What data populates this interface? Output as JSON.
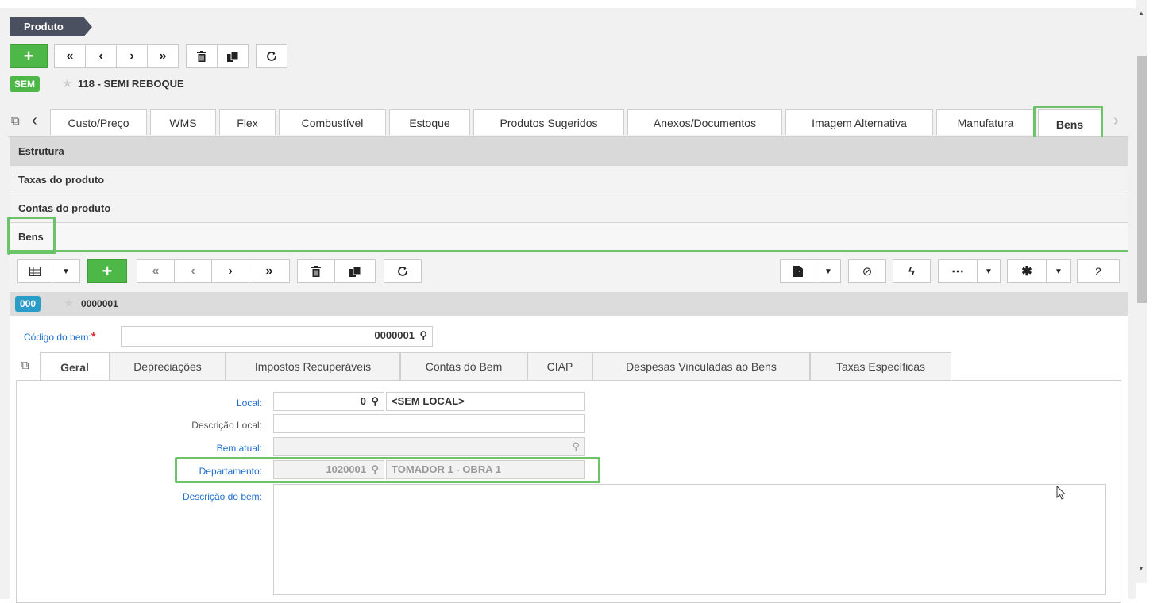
{
  "header": {
    "breadcrumb": "Produto",
    "badge": "SEM",
    "record_title": "118 - SEMI REBOQUE"
  },
  "tabs": [
    {
      "label": "Custo/Preço"
    },
    {
      "label": "WMS"
    },
    {
      "label": "Flex"
    },
    {
      "label": "Combustível"
    },
    {
      "label": "Estoque"
    },
    {
      "label": "Produtos Sugeridos"
    },
    {
      "label": "Anexos/Documentos"
    },
    {
      "label": "Imagem Alternativa"
    },
    {
      "label": "Manufatura"
    },
    {
      "label": "Bens"
    }
  ],
  "sections": [
    "Estrutura",
    "Taxas do produto",
    "Contas do produto",
    "Bens"
  ],
  "inner": {
    "badge": "000",
    "record_title": "0000001",
    "page_count": "2"
  },
  "form": {
    "codigo_label": "Código do bem:",
    "codigo_value": "0000001"
  },
  "inner_tabs": [
    {
      "label": "Geral"
    },
    {
      "label": "Depreciações"
    },
    {
      "label": "Impostos Recuperáveis"
    },
    {
      "label": "Contas do Bem"
    },
    {
      "label": "CIAP"
    },
    {
      "label": "Despesas Vinculadas ao Bens"
    },
    {
      "label": "Taxas Específicas"
    }
  ],
  "geral": {
    "local_label": "Local:",
    "local_value": "0",
    "local_desc": "<SEM LOCAL>",
    "descricao_local_label": "Descrição Local:",
    "bem_atual_label": "Bem atual:",
    "departamento_label": "Departamento:",
    "departamento_value": "1020001",
    "departamento_desc": "TOMADOR 1 - OBRA 1",
    "descricao_bem_label": "Descrição do bem:"
  },
  "colors": {
    "accent_green": "#4db847",
    "highlight_green": "#6cc36a",
    "badge_blue": "#2b9bc9",
    "crumb_dark": "#4b5060",
    "link_blue": "#1f6fd1"
  }
}
